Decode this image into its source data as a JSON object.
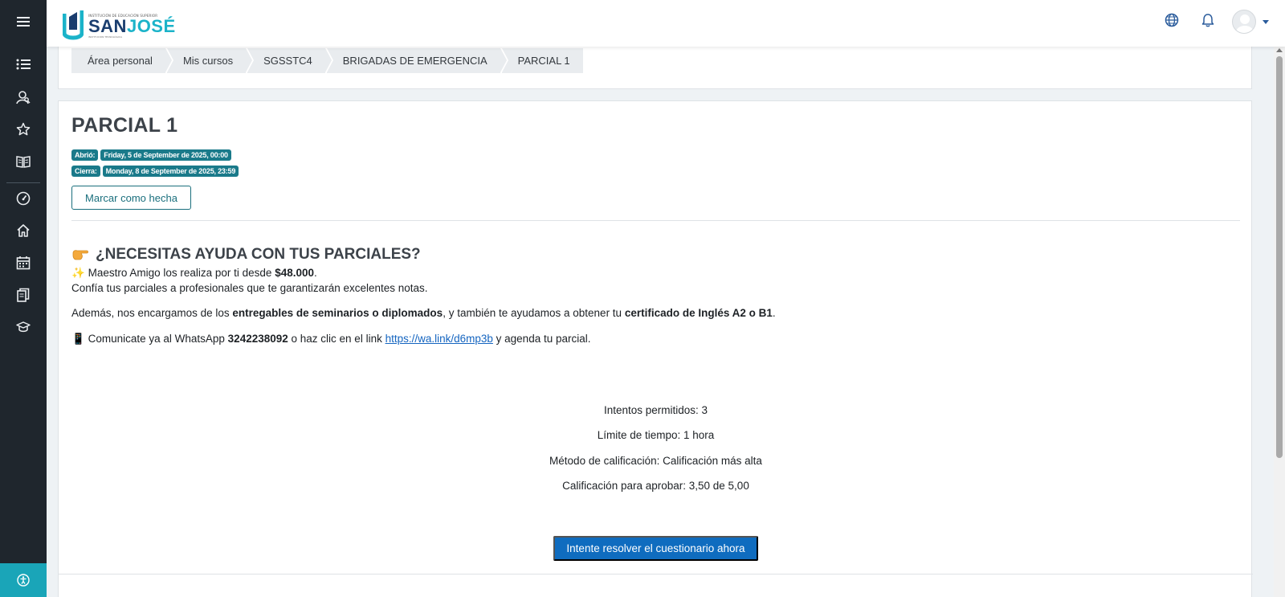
{
  "brand": {
    "logo_small": "INSTITUCIÓN DE EDUCACIÓN SUPERIOR",
    "logo_san": "SAN",
    "logo_jose": "JOSÉ",
    "logo_tiny": "INSTITUCIÓN TECNOLÓGICA",
    "colors": {
      "navy": "#1a3d6e",
      "cyan": "#1bb3c9"
    }
  },
  "rail": {
    "icons": [
      "menu-icon",
      "list-icon",
      "user-search-icon",
      "star-icon",
      "book-icon",
      "dashboard-gauge-icon",
      "home-icon",
      "calendar-icon",
      "courses-icon",
      "graduation-cap-icon",
      "accessibility-icon"
    ]
  },
  "topbar": {
    "icons": [
      "language-globe-icon",
      "notification-bell-icon",
      "user-avatar",
      "user-menu-caret"
    ]
  },
  "breadcrumb": [
    "Área personal",
    "Mis cursos",
    "SGSSTC4",
    "BRIGADAS DE EMERGENCIA",
    "PARCIAL 1"
  ],
  "page": {
    "title": "PARCIAL 1",
    "opened_label": "Abrió:",
    "opened_value": "Friday, 5 de September de 2025, 00:00",
    "closes_label": "Cierra:",
    "closes_value": "Monday, 8 de September de 2025, 23:59",
    "mark_done": "Marcar como hecha"
  },
  "promo": {
    "heading": "¿NECESITAS AYUDA CON TUS PARCIALES?",
    "line1_a": "Maestro Amigo los realiza por ti desde ",
    "line1_price": "$48.000",
    "line1_b": ".",
    "line2": "Confía tus parciales a profesionales que te garantizarán excelentes notas.",
    "line3_a": "Además, nos encargamos de los ",
    "line3_b": "entregables de seminarios o diplomados",
    "line3_c": ", y también te ayudamos a obtener tu ",
    "line3_d": "certificado de Inglés A2 o B1",
    "line3_e": ".",
    "line4_a": "Comunicate ya al WhatsApp ",
    "line4_phone": "3242238092",
    "line4_b": " o haz clic en el link ",
    "line4_link": "https://wa.link/d6mp3b",
    "line4_c": " y agenda tu parcial."
  },
  "quiz": {
    "attempts": "Intentos permitidos: 3",
    "time_limit": "Límite de tiempo: 1 hora",
    "grading": "Método de calificación: Calificación más alta",
    "pass_grade": "Calificación para aprobar: 3,50 de 5,00",
    "start_button": "Intente resolver el cuestionario ahora"
  }
}
